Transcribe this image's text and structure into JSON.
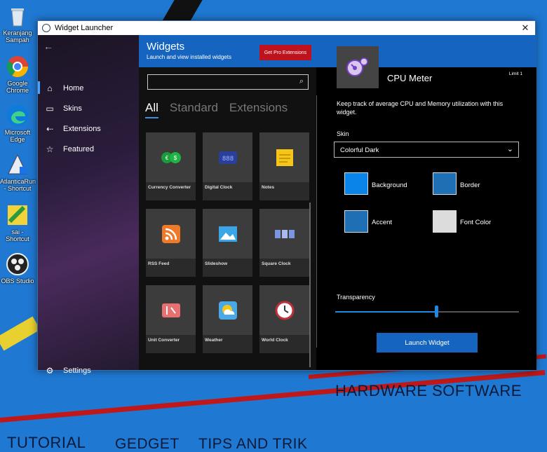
{
  "desktop": {
    "icons": [
      {
        "label": "Keranjang Sampah",
        "icon": "recycle-bin-icon"
      },
      {
        "label": "Google Chrome",
        "icon": "chrome-icon"
      },
      {
        "label": "Microsoft Edge",
        "icon": "edge-icon"
      },
      {
        "label": "AtlanticaRun - Shortcut",
        "icon": "atlantica-icon"
      },
      {
        "label": "sai - Shortcut",
        "icon": "sai-icon"
      },
      {
        "label": "OBS Studio",
        "icon": "obs-icon"
      }
    ],
    "wallpaper_texts": {
      "hardware": "HARDWARE SOFTWARE",
      "tutorial": "TUTORIAL",
      "gedget": "GEDGET",
      "tips": "TIPS AND TRIK"
    }
  },
  "window": {
    "title": "Widget Launcher",
    "close": "✕"
  },
  "nav": {
    "back": "←",
    "items": [
      {
        "label": "Home",
        "icon": "home-icon",
        "glyph": "⌂"
      },
      {
        "label": "Skins",
        "icon": "skins-icon",
        "glyph": "▭"
      },
      {
        "label": "Extensions",
        "icon": "extensions-icon",
        "glyph": "⇠"
      },
      {
        "label": "Featured",
        "icon": "star-icon",
        "glyph": "☆"
      }
    ],
    "settings": {
      "label": "Settings",
      "icon": "gear-icon",
      "glyph": "⚙"
    }
  },
  "header": {
    "title": "Widgets",
    "subtitle": "Launch and view installed widgets",
    "pro_button": "Get Pro Extensions"
  },
  "gallery": {
    "search_placeholder": "",
    "tabs": [
      "All",
      "Standard",
      "Extensions"
    ],
    "active_tab": "All",
    "tiles": [
      {
        "name": "Currency Converter",
        "icon": "currency-icon",
        "color": "#1a9c3a"
      },
      {
        "name": "Digital Clock",
        "icon": "digital-clock-icon",
        "color": "#2a3f9a"
      },
      {
        "name": "Notes",
        "icon": "notes-icon",
        "color": "#f5c518"
      },
      {
        "name": "RSS Feed",
        "icon": "rss-icon",
        "color": "#f07a28"
      },
      {
        "name": "Slideshow",
        "icon": "slideshow-icon",
        "color": "#3aa6e8"
      },
      {
        "name": "Square Clock",
        "icon": "square-clock-icon",
        "color": "#7b95e0"
      },
      {
        "name": "Unit Converter",
        "icon": "unit-converter-icon",
        "color": "#e87070"
      },
      {
        "name": "Weather",
        "icon": "weather-icon",
        "color": "#4aa8e8"
      },
      {
        "name": "World Clock",
        "icon": "world-clock-icon",
        "color": "#c0303a"
      }
    ]
  },
  "detail": {
    "title": "CPU Meter",
    "limit": "Limit 1",
    "description": "Keep track of average CPU and Memory utilization with this widget.",
    "skin_label": "Skin",
    "skin_value": "Colorful Dark",
    "swatches": [
      {
        "label": "Background",
        "color": "#0a84e8"
      },
      {
        "label": "Border",
        "color": "#1f6fb5"
      },
      {
        "label": "Accent",
        "color": "#1f6fb5"
      },
      {
        "label": "Font Color",
        "color": "#dcdcdc"
      }
    ],
    "transparency_label": "Transparency",
    "transparency_value": 0.55,
    "launch_button": "Launch Widget"
  }
}
